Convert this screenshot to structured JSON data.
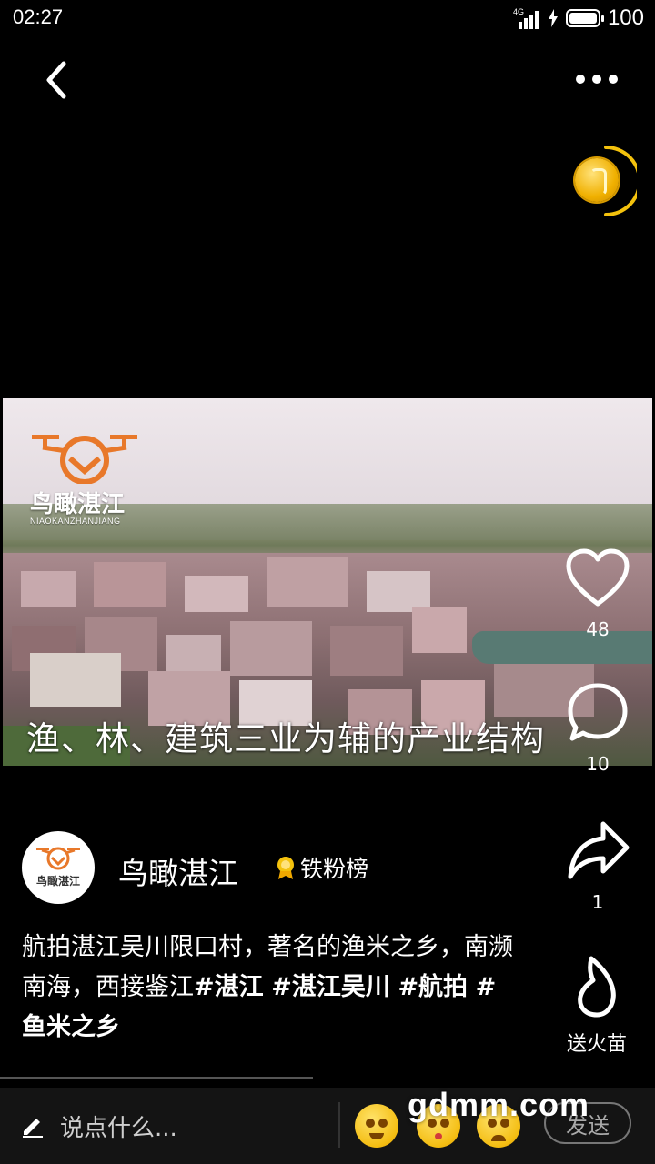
{
  "status_bar": {
    "time": "02:27",
    "network": "4G",
    "battery": "100"
  },
  "video": {
    "watermark_name": "鸟瞰湛江",
    "watermark_pinyin": "NIAOKANZHANJIANG",
    "caption": "渔、林、建筑三业为辅的产业结构"
  },
  "actions": {
    "likes": "48",
    "comments": "10",
    "shares": "1",
    "fire_label": "送火苗"
  },
  "author": {
    "name": "鸟瞰湛江",
    "avatar_text": "鸟瞰湛江",
    "badge": "铁粉榜"
  },
  "description": {
    "text": "航拍湛江吴川限口村，著名的渔米之乡，南濒南海，西接鉴江",
    "tags": [
      "#湛江",
      "#湛江吴川",
      "#航拍",
      "#鱼米之乡"
    ]
  },
  "bottom_bar": {
    "comment_placeholder": "说点什么...",
    "send_label": "发送",
    "site_watermark": "gdmm.com"
  },
  "colors": {
    "background": "#000000",
    "accent_gold": "#f4c20d"
  }
}
